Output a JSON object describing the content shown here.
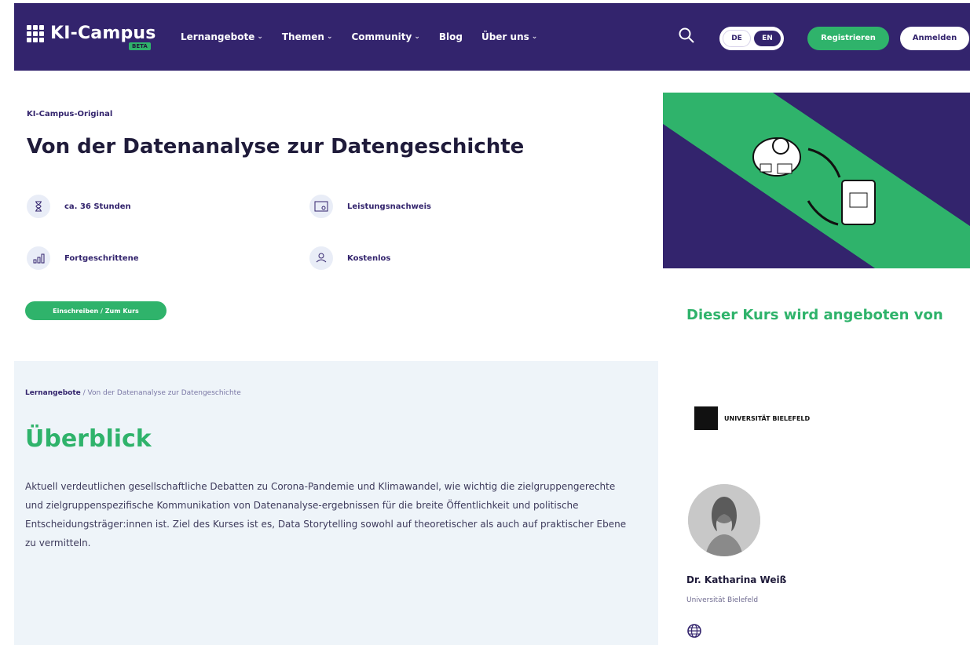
{
  "header": {
    "brand": "KI-Campus",
    "brand_badge": "BETA",
    "menu": [
      {
        "label": "Lernangebote"
      },
      {
        "label": "Themen"
      },
      {
        "label": "Community"
      },
      {
        "label": "Blog"
      },
      {
        "label": "Über uns"
      }
    ],
    "languages": {
      "de": "DE",
      "en": "EN"
    },
    "register_label": "Registrieren",
    "login_label": "Anmelden"
  },
  "course": {
    "badge": "KI-Campus-Original",
    "title": "Von der Datenanalyse zur Datengeschichte",
    "meta": {
      "duration": "ca. 36 Stunden",
      "certificate": "Leistungsnachweis",
      "level": "Fortgeschrittene",
      "price": "Kostenlos"
    },
    "enroll_label": "Einschreiben / Zum Kurs"
  },
  "content": {
    "breadcrumb_root": "Lernangebote",
    "breadcrumb_current": "Von der Datenanalyse zur Datengeschichte",
    "overview_title": "Überblick",
    "description": "Aktuell verdeutlichen gesellschaftliche Debatten zu Corona-Pandemie und Klimawandel, wie wichtig die zielgruppengerechte und zielgruppenspezifische Kommunikation von Datenanalyse-ergebnissen für die breite Öffentlichkeit und politische Entscheidungsträger:innen ist. Ziel des Kurses ist es, Data Storytelling sowohl auf theoretischer als auch auf praktischer Ebene zu vermitteln."
  },
  "sidebar": {
    "offered_by_title": "Dieser Kurs wird angeboten von",
    "institution": "UNIVERSITÄT BIELEFELD",
    "author_name": "Dr. Katharina Weiß",
    "author_affiliation": "Universität Bielefeld"
  },
  "colors": {
    "primary": "#33246d",
    "accent": "#2fb36b",
    "background_light": "#eef4f9"
  }
}
